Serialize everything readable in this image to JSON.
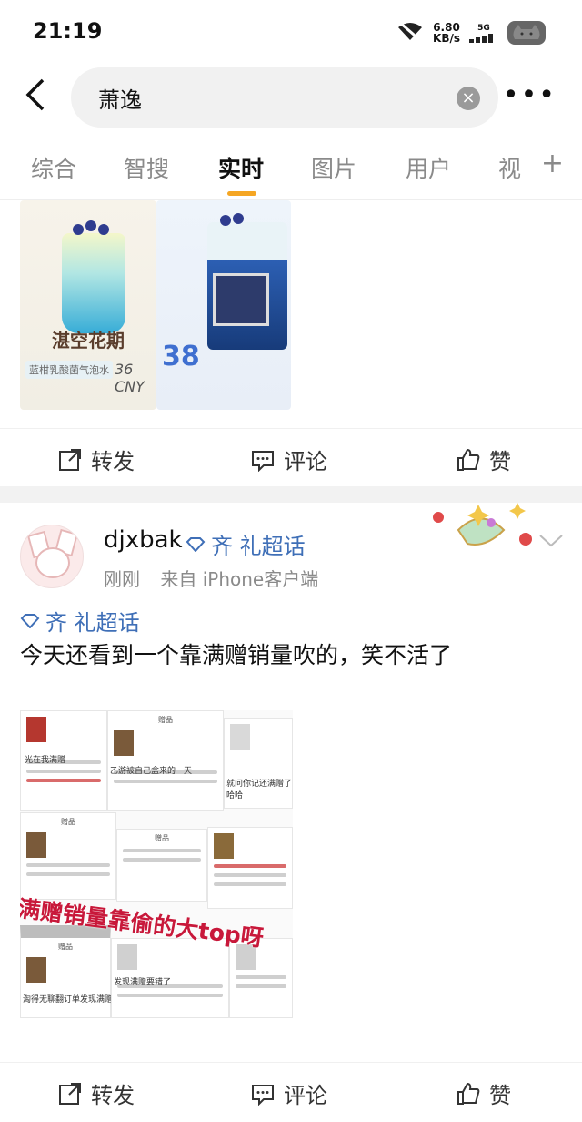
{
  "status": {
    "time": "21:19",
    "speed_value": "6.80",
    "speed_unit": "KB/s",
    "network": "5G",
    "battery_icon": "cat-battery-icon"
  },
  "search": {
    "back_icon": "back-arrow-icon",
    "query": "萧逸",
    "clear_icon": "clear-icon",
    "more_icon": "more-icon"
  },
  "tabs": {
    "items": [
      "综合",
      "智搜",
      "实时",
      "图片",
      "用户",
      "视"
    ],
    "active_index": 2,
    "active_color": "#f5a623",
    "add_label": "+"
  },
  "post1": {
    "promo_title": "湛空花期",
    "promo_subtitle": "蓝柑乳酸菌气泡水",
    "promo_price": "36 CNY",
    "cup_price": "38",
    "actions": {
      "repost": "转发",
      "comment": "评论",
      "like": "赞"
    }
  },
  "post2": {
    "username": "djxbak",
    "topic_header": "齐  礼超话",
    "time": "刚刚",
    "source": "来自 iPhone客户端",
    "topic": "齐  礼超话",
    "text": "今天还看到一个靠满赠销量吹的，笑不活了",
    "image_overlay": "满赠销量靠偷的大top呀",
    "image_snippets": {
      "gift_label": "赠品",
      "caption_1": "光在我满赠",
      "caption_2": "乙游被自己盒来的一天",
      "caption_3": "就问你记还满赠了 哈哈哈哈哈",
      "caption_4": "发现满赠要错了",
      "caption_5": "淘得无聊翻订单发现满赠选错了"
    },
    "actions": {
      "repost": "转发",
      "comment": "评论",
      "like": "赞"
    }
  },
  "colors": {
    "link_blue": "#3f6fb7",
    "overlay_red": "#c8183a",
    "divider_grey": "#f2f2f2"
  }
}
